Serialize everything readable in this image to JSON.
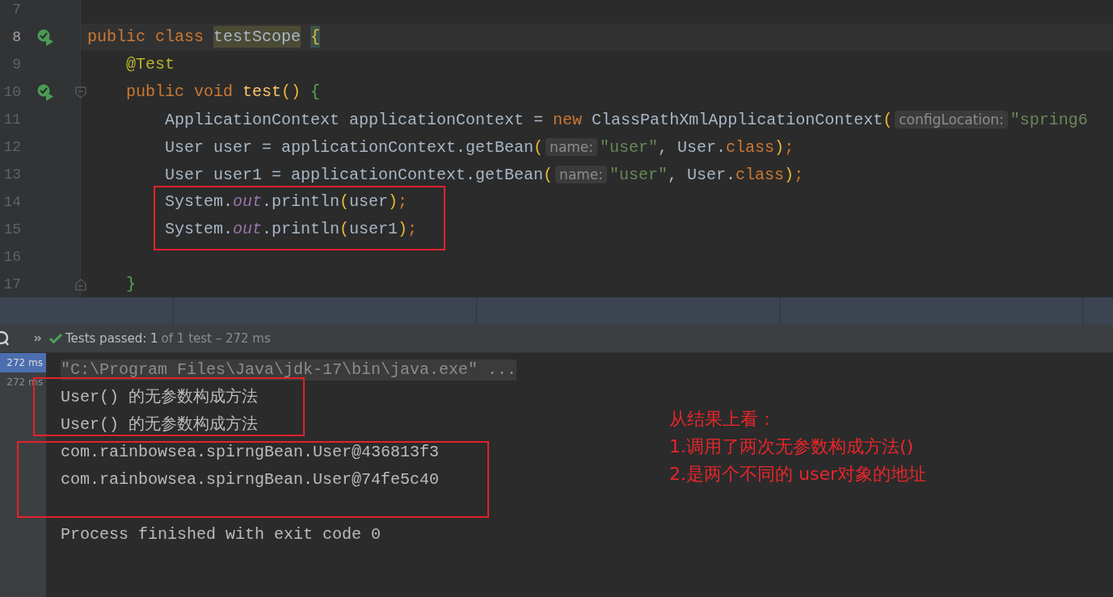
{
  "editor": {
    "lines": [
      {
        "number": "7",
        "current": false,
        "run_icon": false,
        "fold_start": false,
        "fold_end": false
      },
      {
        "number": "8",
        "current": true,
        "run_icon": true,
        "fold_start": false,
        "fold_end": false,
        "tokens": [
          {
            "text": "public class ",
            "kind": "kw"
          },
          {
            "text": "testScope",
            "kind": "ident_hl"
          },
          {
            "text": "{",
            "kind": "brace_match"
          }
        ]
      },
      {
        "number": "9",
        "current": false,
        "run_icon": false,
        "fold_start": false,
        "fold_end": false,
        "tokens": [
          {
            "text": "    @Test",
            "kind": "annotation"
          }
        ]
      },
      {
        "number": "10",
        "current": false,
        "run_icon": true,
        "fold_start": true,
        "fold_end": false,
        "tokens": [
          {
            "text": "    public void ",
            "kind": "kw"
          },
          {
            "text": "test",
            "kind": "method"
          },
          {
            "text": "()",
            "kind": "paren"
          },
          {
            "text": " {",
            "kind": "brace2"
          }
        ]
      },
      {
        "number": "11",
        "current": false,
        "run_icon": false,
        "fold_start": false,
        "fold_end": false,
        "tokens": [
          {
            "text": "        ApplicationContext applicationContext = ",
            "kind": "plain"
          },
          {
            "text": "new ",
            "kind": "kw"
          },
          {
            "text": "ClassPathXmlApplicationContext",
            "kind": "plain"
          },
          {
            "text": "(",
            "kind": "paren"
          },
          {
            "text": "configLocation:",
            "kind": "hint"
          },
          {
            "text": "\"spring6",
            "kind": "string"
          }
        ]
      },
      {
        "number": "12",
        "current": false,
        "run_icon": false,
        "fold_start": false,
        "fold_end": false,
        "tokens": [
          {
            "text": "        User user = applicationContext.getBean",
            "kind": "plain"
          },
          {
            "text": "(",
            "kind": "paren"
          },
          {
            "text": "name:",
            "kind": "hint"
          },
          {
            "text": "\"user\"",
            "kind": "string"
          },
          {
            "text": ", User.",
            "kind": "plain"
          },
          {
            "text": "class",
            "kind": "kw"
          },
          {
            "text": ")",
            "kind": "paren"
          },
          {
            "text": ";",
            "kind": "kw"
          }
        ]
      },
      {
        "number": "13",
        "current": false,
        "run_icon": false,
        "fold_start": false,
        "fold_end": false,
        "tokens": [
          {
            "text": "        User user1 = applicationContext.getBean",
            "kind": "plain"
          },
          {
            "text": "(",
            "kind": "paren"
          },
          {
            "text": "name:",
            "kind": "hint"
          },
          {
            "text": "\"user\"",
            "kind": "string"
          },
          {
            "text": ", User.",
            "kind": "plain"
          },
          {
            "text": "class",
            "kind": "kw"
          },
          {
            "text": ")",
            "kind": "paren"
          },
          {
            "text": ";",
            "kind": "kw"
          }
        ]
      },
      {
        "number": "14",
        "current": false,
        "run_icon": false,
        "fold_start": false,
        "fold_end": false,
        "tokens": [
          {
            "text": "        System.",
            "kind": "plain"
          },
          {
            "text": "out",
            "kind": "field"
          },
          {
            "text": ".println",
            "kind": "plain"
          },
          {
            "text": "(",
            "kind": "paren"
          },
          {
            "text": "user",
            "kind": "plain"
          },
          {
            "text": ")",
            "kind": "paren"
          },
          {
            "text": ";",
            "kind": "kw"
          }
        ]
      },
      {
        "number": "15",
        "current": false,
        "run_icon": false,
        "fold_start": false,
        "fold_end": false,
        "tokens": [
          {
            "text": "        System.",
            "kind": "plain"
          },
          {
            "text": "out",
            "kind": "field"
          },
          {
            "text": ".println",
            "kind": "plain"
          },
          {
            "text": "(",
            "kind": "paren"
          },
          {
            "text": "user1",
            "kind": "plain"
          },
          {
            "text": ")",
            "kind": "paren"
          },
          {
            "text": ";",
            "kind": "kw"
          }
        ]
      },
      {
        "number": "16",
        "current": false,
        "run_icon": false,
        "fold_start": false,
        "fold_end": false
      },
      {
        "number": "17",
        "current": false,
        "run_icon": false,
        "fold_start": false,
        "fold_end": true,
        "tokens": [
          {
            "text": "    }",
            "kind": "brace2"
          }
        ]
      }
    ]
  },
  "test_toolbar": {
    "status": "Tests passed: 1",
    "detail": "of 1 test – 272 ms"
  },
  "test_tree": {
    "items": [
      {
        "label": "272 ms",
        "selected": true
      },
      {
        "label": "272 ms",
        "selected": false
      }
    ]
  },
  "console": {
    "lines": [
      {
        "kind": "command",
        "text": "\"C:\\Program Files\\Java\\jdk-17\\bin\\java.exe\" ..."
      },
      {
        "kind": "stdout",
        "text": "User() 的无参数构成方法"
      },
      {
        "kind": "stdout",
        "text": "User() 的无参数构成方法"
      },
      {
        "kind": "stdout",
        "text": "com.rainbowsea.spirngBean.User@436813f3"
      },
      {
        "kind": "stdout",
        "text": "com.rainbowsea.spirngBean.User@74fe5c40"
      },
      {
        "kind": "blank"
      },
      {
        "kind": "stdout",
        "text": "Process finished with exit code 0"
      }
    ]
  },
  "annotation_note": {
    "lines": [
      "从结果上看：",
      "1.调用了两次无参数构成方法()",
      "2.是两个不同的 user对象的地址"
    ]
  }
}
